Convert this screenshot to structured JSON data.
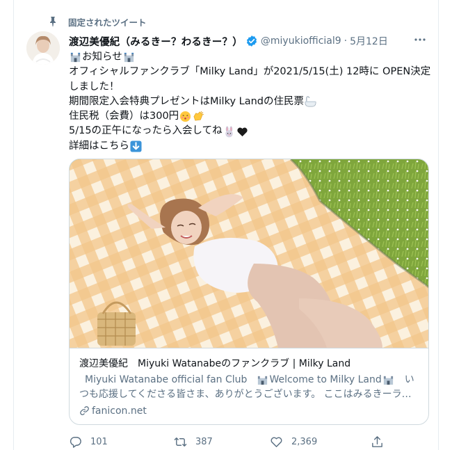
{
  "pinned_label": "固定されたツイート",
  "author": {
    "name": "渡辺美優紀（みるきー？わるきー？）",
    "handle": "@miyukiofficial9",
    "separator": "·",
    "date": "5月12日"
  },
  "tweet": {
    "line1": "お知らせ",
    "line2": "オフィシャルファンクラブ「Milky Land」が2021/5/15(土) 12時に OPEN決定",
    "line3": "しました！",
    "line4": "期間限定入会特典プレゼントはMilky Landの住民票",
    "line5": "住民税（会費）は300円",
    "line6": "5/15の正午になったら入会してね",
    "line7": "詳細はこちら"
  },
  "link_card": {
    "title": "渡辺美優紀　Miyuki Watanabeのファンクラブ | Milky Land",
    "desc_part1": "Miyuki Watanabe official fan Club",
    "desc_part2": "Welcome to Milky Land",
    "desc_part3": "い",
    "desc_line2": "つも応援してくださる皆さま、ありがとうございます。 ここはみるきーラ…",
    "domain": "fanicon.net"
  },
  "actions": {
    "replies": "101",
    "retweets": "387",
    "likes": "2,369"
  },
  "colors": {
    "verified": "#1d9bf0",
    "secondary_text": "#5b7083",
    "border": "#cfd9de"
  },
  "icons": [
    "pin-icon",
    "verified-icon",
    "more-icon",
    "castle-emoji",
    "bathtub-emoji",
    "kiss-emoji",
    "clap-emoji",
    "rabbit-emoji",
    "heart-emoji",
    "down-arrow-emoji",
    "link-icon",
    "reply-icon",
    "retweet-icon",
    "like-icon",
    "share-icon"
  ]
}
